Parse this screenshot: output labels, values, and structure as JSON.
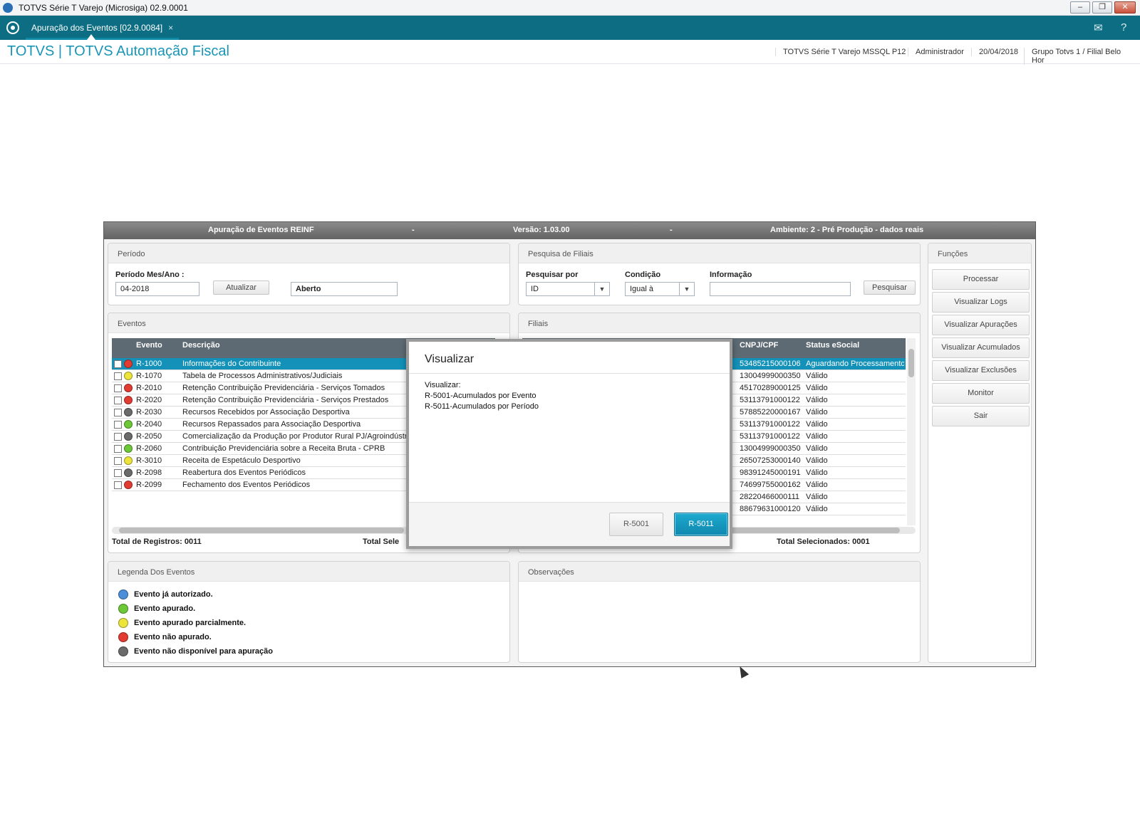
{
  "window": {
    "title": "TOTVS Série T Varejo (Microsiga) 02.9.0001"
  },
  "tabs": [
    {
      "label": "Apuração dos Eventos [02.9.0084]",
      "close": "×"
    }
  ],
  "header": {
    "app_title": "TOTVS | TOTVS Automação Fiscal",
    "environment": "TOTVS Série T Varejo MSSQL P12",
    "user": "Administrador",
    "date": "20/04/2018",
    "branch": "Grupo Totvs 1 / Filial Belo Hor"
  },
  "panel_header": {
    "title": "Apuração de Eventos REINF",
    "sep": "-",
    "version": "Versão: 1.03.00",
    "environment": "Ambiente: 2 - Pré Produção - dados reais"
  },
  "periodo": {
    "title": "Período",
    "label": "Período Mes/Ano :",
    "value": "04-2018",
    "update_button": "Atualizar",
    "status": "Aberto"
  },
  "pesquisa": {
    "title": "Pesquisa de Filiais",
    "search_by_label": "Pesquisar por",
    "search_by_value": "ID",
    "condition_label": "Condição",
    "condition_value": "Igual à",
    "info_label": "Informação",
    "info_value": "",
    "search_button": "Pesquisar"
  },
  "funcoes": {
    "title": "Funções",
    "buttons": [
      "Processar",
      "Visualizar Logs",
      "Visualizar Apurações",
      "Visualizar Acumulados",
      "Visualizar Exclusões",
      "Monitor",
      "Sair"
    ]
  },
  "eventos": {
    "title": "Eventos",
    "columns": {
      "evento": "Evento",
      "descricao": "Descrição"
    },
    "rows": [
      {
        "code": "R-1000",
        "desc": "Informações do Contribuinte",
        "status": "red",
        "selected": true
      },
      {
        "code": "R-1070",
        "desc": "Tabela de Processos Administrativos/Judiciais",
        "status": "yellow",
        "selected": false
      },
      {
        "code": "R-2010",
        "desc": "Retenção Contribuição Previdenciária - Serviços Tomados",
        "status": "red",
        "selected": false
      },
      {
        "code": "R-2020",
        "desc": "Retenção Contribuição Previdenciária - Serviços Prestados",
        "status": "red",
        "selected": false
      },
      {
        "code": "R-2030",
        "desc": "Recursos Recebidos por Associação Desportiva",
        "status": "gray",
        "selected": false
      },
      {
        "code": "R-2040",
        "desc": "Recursos Repassados para Associação Desportiva",
        "status": "green",
        "selected": false
      },
      {
        "code": "R-2050",
        "desc": "Comercialização da Produção por Produtor Rural PJ/Agroindústria",
        "status": "gray",
        "selected": false
      },
      {
        "code": "R-2060",
        "desc": "Contribuição Previdenciária sobre a Receita Bruta - CPRB",
        "status": "green",
        "selected": false
      },
      {
        "code": "R-3010",
        "desc": "Receita de Espetáculo Desportivo",
        "status": "yellow",
        "selected": false
      },
      {
        "code": "R-2098",
        "desc": "Reabertura dos Eventos Periódicos",
        "status": "gray",
        "selected": false
      },
      {
        "code": "R-2099",
        "desc": "Fechamento dos Eventos Periódicos",
        "status": "red",
        "selected": false
      }
    ],
    "total_registros": "Total de Registros: 0011",
    "total_selecionados": "Total Sele"
  },
  "filiais": {
    "title": "Filiais",
    "columns": {
      "cnpj": "CNPJ/CPF",
      "status": "Status eSocial"
    },
    "rows": [
      {
        "cnpj": "53485215000106",
        "status": "Aguardando Processamento",
        "selected": true
      },
      {
        "cnpj": "13004999000350",
        "status": "Válido",
        "selected": false
      },
      {
        "cnpj": "45170289000125",
        "status": "Válido",
        "selected": false
      },
      {
        "cnpj": "53113791000122",
        "status": "Válido",
        "selected": false
      },
      {
        "cnpj": "57885220000167",
        "status": "Válido",
        "selected": false
      },
      {
        "cnpj": "53113791000122",
        "status": "Válido",
        "selected": false
      },
      {
        "cnpj": "53113791000122",
        "status": "Válido",
        "selected": false
      },
      {
        "cnpj": "13004999000350",
        "status": "Válido",
        "selected": false
      },
      {
        "cnpj": "26507253000140",
        "status": "Válido",
        "selected": false
      },
      {
        "cnpj": "98391245000191",
        "status": "Válido",
        "selected": false
      },
      {
        "cnpj": "74699755000162",
        "status": "Válido",
        "selected": false
      },
      {
        "cnpj": "28220466000111",
        "status": "Válido",
        "selected": false
      },
      {
        "cnpj": "88679631000120",
        "status": "Válido",
        "selected": false
      }
    ],
    "total_selecionados": "Total Selecionados: 0001"
  },
  "legenda": {
    "title": "Legenda Dos Eventos",
    "items": [
      {
        "color": "blue",
        "label": "Evento já autorizado."
      },
      {
        "color": "green",
        "label": "Evento apurado."
      },
      {
        "color": "yellow",
        "label": "Evento apurado parcialmente."
      },
      {
        "color": "red",
        "label": "Evento não apurado."
      },
      {
        "color": "gray",
        "label": "Evento não disponível para apuração"
      }
    ]
  },
  "observacoes": {
    "title": "Observações"
  },
  "modal": {
    "title": "Visualizar",
    "lines": [
      "Visualizar:",
      "R-5001-Acumulados por Evento",
      "R-5011-Acumulados por Período"
    ],
    "buttons": [
      "R-5001",
      "R-5011"
    ]
  },
  "colors": {
    "red": "#e23b32",
    "yellow": "#ece43a",
    "green": "#6cc836",
    "gray": "#6a6a6a",
    "blue": "#4a8fd8",
    "accent": "#0d6d82",
    "selection": "#1391b8"
  }
}
